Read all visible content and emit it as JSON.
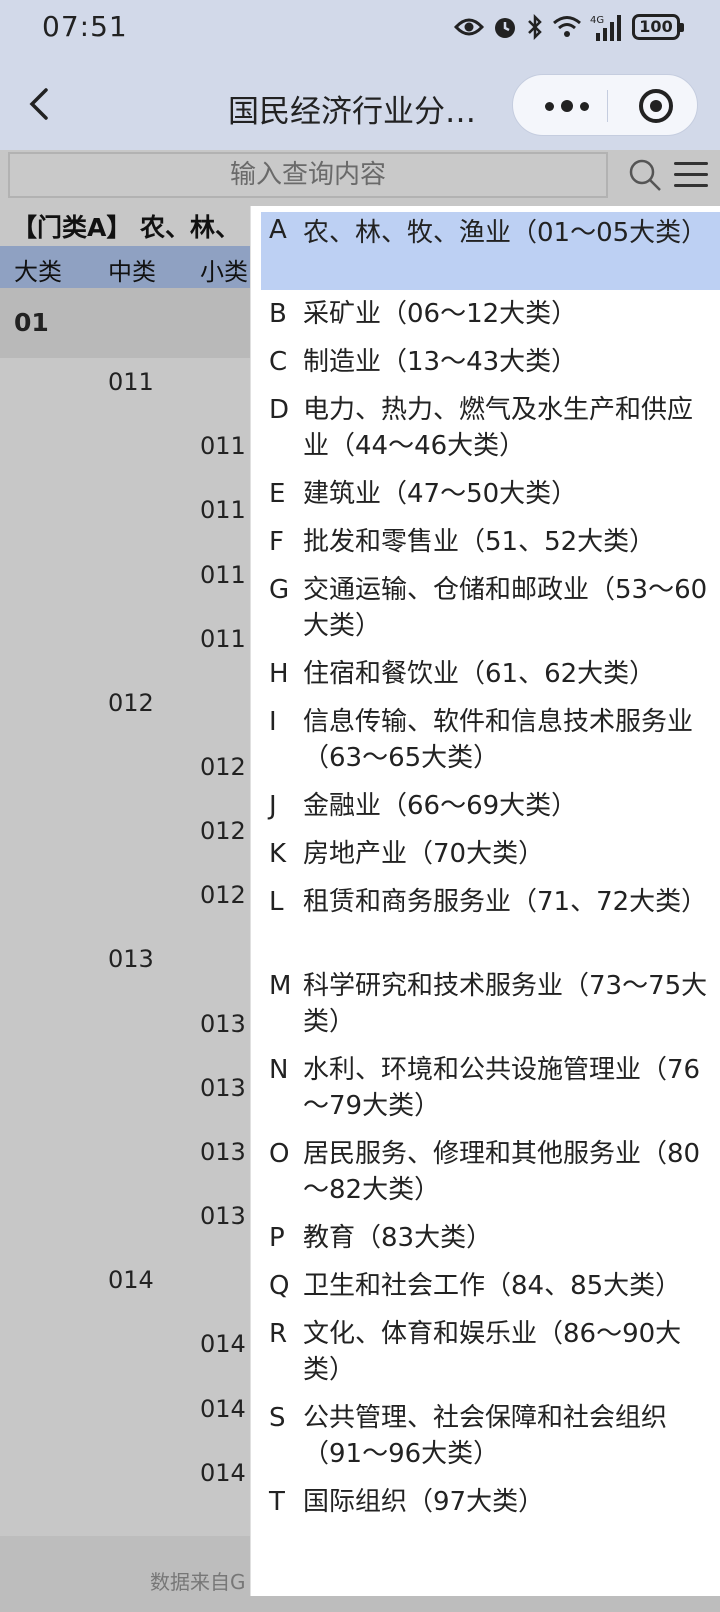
{
  "status": {
    "time": "07:51",
    "network": "4G",
    "battery": "100"
  },
  "header": {
    "title": "国民经济行业分…"
  },
  "search": {
    "placeholder": "输入查询内容"
  },
  "section": {
    "title": "【门类A】 农、林、"
  },
  "table": {
    "columns": [
      "大类",
      "中类",
      "小类"
    ],
    "major_code": "01",
    "mid_codes": [
      "011",
      "012",
      "013",
      "014"
    ],
    "minor_codes_partial": [
      "011",
      "011",
      "011",
      "011",
      "012",
      "012",
      "012",
      "013",
      "013",
      "013",
      "013",
      "014",
      "014",
      "014"
    ]
  },
  "footer": {
    "text": "数据来自G"
  },
  "dropdown": {
    "items": [
      {
        "letter": "A",
        "label": "农、林、牧、渔业（01～05大类）",
        "active": true
      },
      {
        "letter": "B",
        "label": "采矿业（06～12大类）"
      },
      {
        "letter": "C",
        "label": "制造业（13～43大类）"
      },
      {
        "letter": "D",
        "label": "电力、热力、燃气及水生产和供应业（44～46大类）"
      },
      {
        "letter": "E",
        "label": "建筑业（47～50大类）"
      },
      {
        "letter": "F",
        "label": "批发和零售业（51、52大类）"
      },
      {
        "letter": "G",
        "label": "交通运输、仓储和邮政业（53～60大类）"
      },
      {
        "letter": "H",
        "label": "住宿和餐饮业（61、62大类）"
      },
      {
        "letter": "I",
        "label": "信息传输、软件和信息技术服务业（63～65大类）"
      },
      {
        "letter": "J",
        "label": "金融业（66～69大类）"
      },
      {
        "letter": "K",
        "label": "房地产业（70大类）"
      },
      {
        "letter": "L",
        "label": "租赁和商务服务业（71、72大类）"
      },
      {
        "letter": "M",
        "label": "科学研究和技术服务业（73～75大类）"
      },
      {
        "letter": "N",
        "label": "水利、环境和公共设施管理业（76～79大类）"
      },
      {
        "letter": "O",
        "label": "居民服务、修理和其他服务业（80～82大类）"
      },
      {
        "letter": "P",
        "label": "教育（83大类）"
      },
      {
        "letter": "Q",
        "label": "卫生和社会工作（84、85大类）"
      },
      {
        "letter": "R",
        "label": "文化、体育和娱乐业（86～90大类）"
      },
      {
        "letter": "S",
        "label": "公共管理、社会保障和社会组织（91～96大类）"
      },
      {
        "letter": "T",
        "label": "国际组织（97大类）"
      }
    ]
  }
}
